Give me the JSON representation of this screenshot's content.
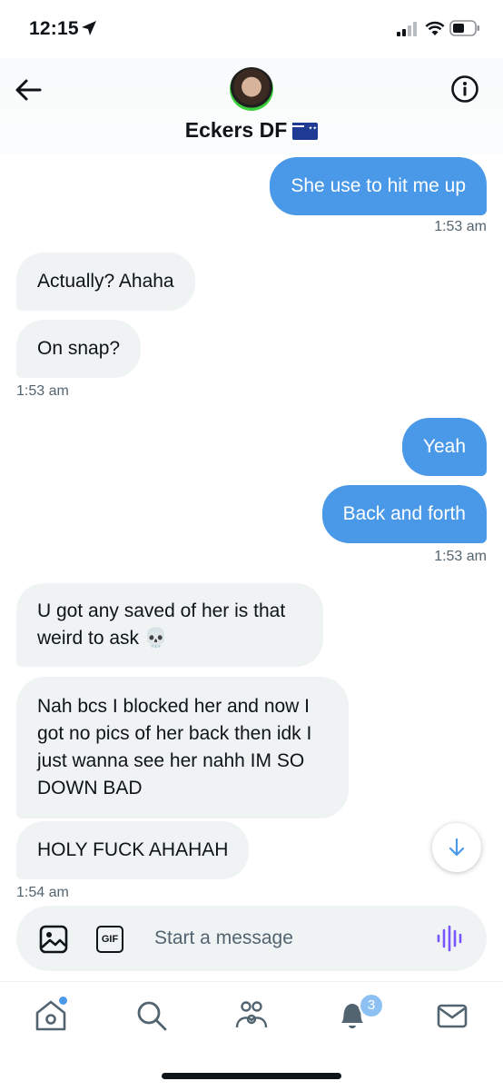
{
  "status_bar": {
    "time": "12:15"
  },
  "header": {
    "contact_name": "Eckers DF"
  },
  "messages": [
    {
      "side": "sent",
      "text": "She use to hit me up"
    },
    {
      "side": "sent",
      "timestamp": "1:53 am"
    },
    {
      "side": "recv",
      "text": "Actually? Ahaha"
    },
    {
      "side": "recv",
      "text": "On snap?"
    },
    {
      "side": "recv",
      "timestamp": "1:53 am"
    },
    {
      "side": "sent",
      "text": "Yeah"
    },
    {
      "side": "sent",
      "text": "Back and forth"
    },
    {
      "side": "sent",
      "timestamp": "1:53 am"
    },
    {
      "side": "recv",
      "text": "U got any saved of her is that weird to ask 💀"
    },
    {
      "side": "recv",
      "text": "Nah bcs I blocked her and now I got no pics of her back then idk I just wanna see her nahh IM SO DOWN BAD"
    },
    {
      "side": "recv",
      "text": "HOLY FUCK AHAHAH"
    },
    {
      "side": "recv",
      "timestamp": "1:54 am"
    }
  ],
  "composer": {
    "placeholder": "Start a message"
  },
  "tabbar": {
    "notifications_count": "3"
  },
  "colors": {
    "accent": "#4a99e9",
    "received_bubble": "#eff3f4",
    "voice": "#7856ff"
  }
}
